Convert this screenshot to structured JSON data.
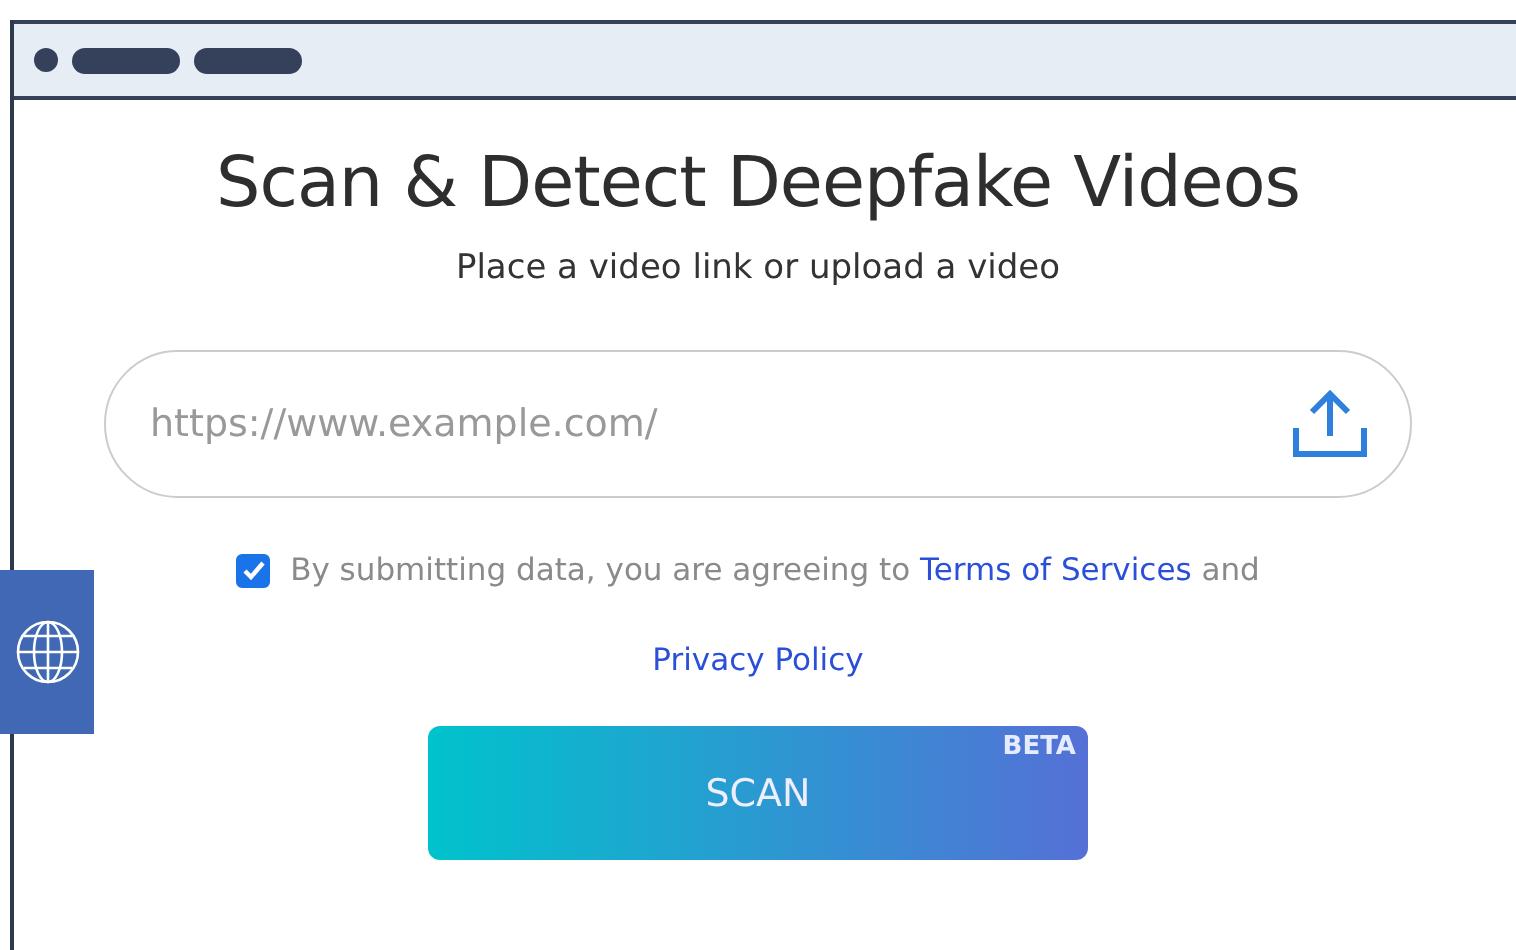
{
  "title": "Scan & Detect Deepfake Videos",
  "subtitle": "Place a video link or upload a video",
  "url_field": {
    "placeholder": "https://www.example.com/"
  },
  "consent": {
    "checked": true,
    "text": "By submitting data, you are agreeing to",
    "terms_link": "Terms of Services",
    "joiner": "and",
    "privacy_link": "Privacy Policy"
  },
  "scan_button": {
    "label": "SCAN",
    "badge": "BETA"
  }
}
